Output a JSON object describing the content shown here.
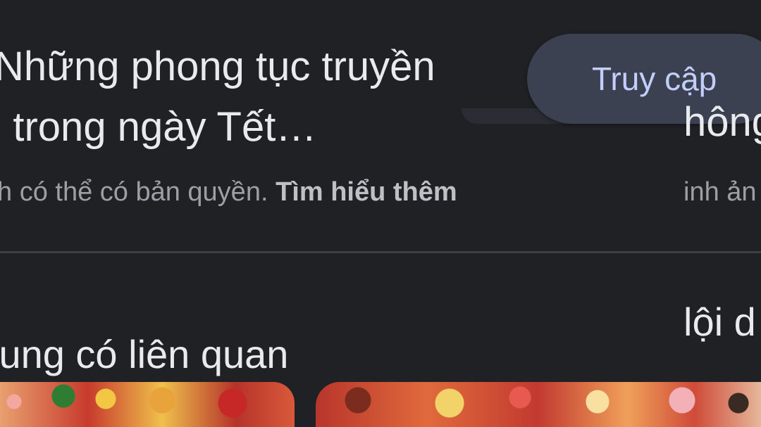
{
  "result_card": {
    "title_line1": "Những phong tục truyền",
    "title_line2": "g trong ngày Tết…",
    "copyright_notice": "h có thể có bản quyền.",
    "learn_more": "Tìm hiểu thêm"
  },
  "visit_button": {
    "label": "Truy cập"
  },
  "related_section": {
    "heading": "lung có liên quan"
  },
  "next_card_peek": {
    "title": "hông",
    "copyright_notice": "inh ản",
    "heading": "lội d"
  },
  "icons": {
    "thumbnails": "tet-illustration-image"
  },
  "colors": {
    "background": "#202124",
    "button_background": "#3c4152",
    "button_text": "#c2cffb",
    "divider": "#3c4043"
  }
}
